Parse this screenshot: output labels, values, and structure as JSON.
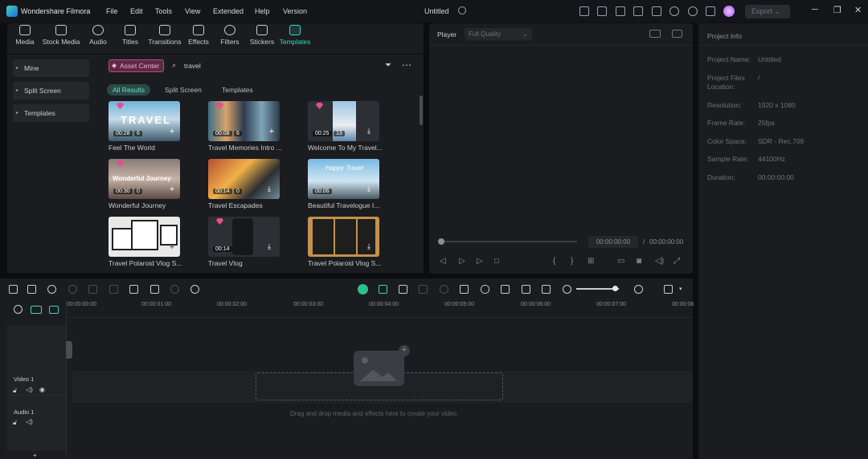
{
  "app": {
    "name": "Wondershare Filmora",
    "project_title": "Untitled",
    "export_label": "Export"
  },
  "menu": [
    "File",
    "Edit",
    "Tools",
    "View",
    "Extended",
    "Help",
    "Version"
  ],
  "tabs": [
    {
      "label": "Media",
      "icon": "media-icon"
    },
    {
      "label": "Stock Media",
      "icon": "stock-media-icon"
    },
    {
      "label": "Audio",
      "icon": "audio-icon"
    },
    {
      "label": "Titles",
      "icon": "titles-icon"
    },
    {
      "label": "Transitions",
      "icon": "transitions-icon"
    },
    {
      "label": "Effects",
      "icon": "effects-icon"
    },
    {
      "label": "Filters",
      "icon": "filters-icon"
    },
    {
      "label": "Stickers",
      "icon": "stickers-icon"
    },
    {
      "label": "Templates",
      "icon": "templates-icon"
    }
  ],
  "sidebar": [
    "Mine",
    "Split Screen",
    "Templates"
  ],
  "browser": {
    "asset_center": "Asset Center",
    "search_value": "travel",
    "filters": [
      "All Results",
      "Split Screen",
      "Templates"
    ]
  },
  "templates": [
    {
      "title": "Feel The World",
      "duration": "00:28",
      "count": "6",
      "overlay": "TRAVEL"
    },
    {
      "title": "Travel Memories Intro ...",
      "duration": "00:08",
      "count": "6",
      "overlay": ""
    },
    {
      "title": "Welcome To My Travel...",
      "duration": "00:25",
      "count": "13",
      "overlay": ""
    },
    {
      "title": "Wonderful Journey",
      "duration": "00:30",
      "count": "0",
      "overlay": "Wonderful Journey"
    },
    {
      "title": "Travel Escapades",
      "duration": "00:14",
      "count": "0",
      "overlay": ""
    },
    {
      "title": "Beautiful Travelogue I...",
      "duration": "00:06",
      "count": "",
      "overlay": "Happy Travel"
    },
    {
      "title": "Travel Polaroid Vlog S...",
      "duration": "",
      "count": "",
      "overlay": ""
    },
    {
      "title": "Travel Vlog",
      "duration": "00:14",
      "count": "",
      "overlay": ""
    },
    {
      "title": "Travel Polaroid Vlog S...",
      "duration": "",
      "count": "",
      "overlay": ""
    }
  ],
  "player": {
    "label": "Player",
    "quality": "Full Quality",
    "current_time": "00:00:00:00",
    "separator": "/",
    "total_time": "00:00:00:00"
  },
  "project_info": {
    "heading": "Project Info",
    "rows": [
      {
        "label": "Project Name:",
        "value": "Untitled"
      },
      {
        "label": "Project Files Location:",
        "value": "/"
      },
      {
        "label": "Resolution:",
        "value": "1920 x 1080"
      },
      {
        "label": "Frame Rate:",
        "value": "25fps"
      },
      {
        "label": "Color Space:",
        "value": "SDR - Rec.709"
      },
      {
        "label": "Sample Rate:",
        "value": "44100Hz"
      },
      {
        "label": "Duration:",
        "value": "00:00:00:00"
      }
    ]
  },
  "timeline": {
    "ruler": [
      "00:00:00:00",
      "00:00:01:00",
      "00:00:02:00",
      "00:00:03:00",
      "00:00:04:00",
      "00:00:05:00",
      "00:00:06:00",
      "00:00:07:00",
      "00:00:08"
    ],
    "tracks": [
      "Video 1",
      "Audio 1"
    ],
    "drop_hint": "Drag and drop media and effects here to create your video.",
    "zoom_level": 0.92
  }
}
